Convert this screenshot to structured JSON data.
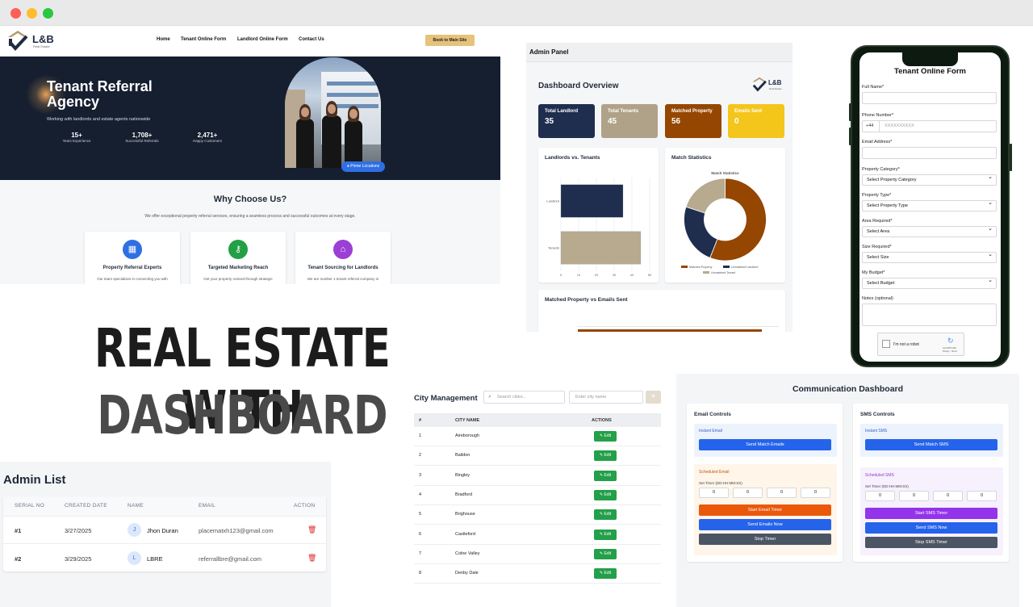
{
  "landing": {
    "logo": {
      "text": "L&B",
      "sub": "Real Estate"
    },
    "nav": [
      "Home",
      "Tenant Online Form",
      "Landlord Online Form",
      "Contact Us"
    ],
    "cta": "Book to Main Site",
    "hero_title": "Tenant Referral Agency",
    "hero_sub": "Working with landlords and estate agents nationwide",
    "stats": [
      {
        "value": "15+",
        "label": "Years Experience"
      },
      {
        "value": "1,708+",
        "label": "Successful Referrals"
      },
      {
        "value": "2,471+",
        "label": "Happy Customers"
      }
    ],
    "prime_badge": "Prime Locations",
    "why_title": "Why Choose Us?",
    "why_sub": "We offer exceptional property referral services, ensuring a seamless process and successful outcomes at every stage.",
    "cards": [
      {
        "title": "Property Referral Experts",
        "desc": "Our team specialises in connecting you with",
        "color": "#2f6fe4",
        "icon": "building-icon"
      },
      {
        "title": "Targeted Marketing Reach",
        "desc": "Get your property noticed through strategic",
        "color": "#22a046",
        "icon": "key-icon"
      },
      {
        "title": "Tenant Sourcing for Landlords",
        "desc": "We are number 1 tenant referral company in",
        "color": "#9b3fd6",
        "icon": "house-icon"
      }
    ]
  },
  "headline": {
    "line1": "REAL ESTATE WITH",
    "line2": "DASHBOARD"
  },
  "admin_panel": {
    "bar_title": "Admin Panel",
    "title": "Dashboard Overview",
    "logo_text": "L&B",
    "logo_sub": "Real Estate",
    "kpis": [
      {
        "label": "Total Landlord",
        "value": "35",
        "color": "#1f2d4e"
      },
      {
        "label": "Total Tenants",
        "value": "45",
        "color": "#b0a288"
      },
      {
        "label": "Matched Property",
        "value": "56",
        "color": "#954600"
      },
      {
        "label": "Emails Sent",
        "value": "0",
        "color": "#f4c61c"
      }
    ],
    "bar_chart_title": "Landlords vs. Tenants",
    "pie_chart_title": "Match Statistics",
    "bottom_chart_title": "Matched Property vs Emails Sent"
  },
  "chart_data": [
    {
      "type": "bar",
      "title": "Landlords vs. Tenants",
      "orientation": "horizontal",
      "categories": [
        "Landlord",
        "Tenants"
      ],
      "values": [
        35,
        45
      ],
      "colors": [
        "#1f2d4e",
        "#b7aa8e"
      ],
      "xticks": [
        "0",
        "10",
        "20",
        "30",
        "40",
        "50"
      ],
      "xlim": [
        0,
        50
      ]
    },
    {
      "type": "pie",
      "title": "Match Statistics",
      "donut": true,
      "labels": [
        "Matched Property",
        "Unmatched Landlord",
        "Unmatched Tenant"
      ],
      "values": [
        56,
        24,
        20
      ],
      "colors": [
        "#954600",
        "#1f2d4e",
        "#b7aa8e"
      ]
    }
  ],
  "phone_form": {
    "title": "Tenant Online Form",
    "fields": {
      "full_name": "Full Name*",
      "phone": "Phone Number*",
      "phone_code": "+44",
      "phone_placeholder": "XXXXXXXXXX",
      "email": "Email Address*",
      "category_label": "Property Category*",
      "category_value": "Select Property Category",
      "type_label": "Property Type*",
      "type_value": "Select Property Type",
      "area_label": "Area Required*",
      "area_value": "Select Area",
      "size_label": "Size Required*",
      "size_value": "Select Size",
      "budget_label": "My Budget*",
      "budget_value": "Select Budget",
      "notes_label": "Notes (optional)",
      "captcha": "I'm not a robot",
      "captcha_brand": "reCAPTCHA",
      "captcha_links": "Privacy - Terms"
    }
  },
  "city": {
    "title": "City Management",
    "search_placeholder": "Search cities...",
    "input_placeholder": "Enter city name",
    "add": "+",
    "headers": [
      "#",
      "CITY NAME",
      "ACTIONS"
    ],
    "edit_label": "Edit",
    "rows": [
      {
        "n": "1",
        "name": "Aireborough"
      },
      {
        "n": "2",
        "name": "Baildon"
      },
      {
        "n": "3",
        "name": "Bingley"
      },
      {
        "n": "4",
        "name": "Bradford"
      },
      {
        "n": "5",
        "name": "Brighouse"
      },
      {
        "n": "6",
        "name": "Castleford"
      },
      {
        "n": "7",
        "name": "Colne Valley"
      },
      {
        "n": "8",
        "name": "Denby Dale"
      }
    ]
  },
  "comm": {
    "title": "Communication Dashboard",
    "email": {
      "title": "Email Controls",
      "instant": "Instant Email",
      "send_match": "Send Match Emails",
      "scheduled": "Scheduled Email",
      "timer_label": "Set Timer (DD:HH:MM:SS)",
      "timer": [
        "0",
        "0",
        "0",
        "0"
      ],
      "start": "Start Email Timer",
      "send_now": "Send Emails Now",
      "stop": "Stop Timer"
    },
    "sms": {
      "title": "SMS Controls",
      "instant": "Instant SMS",
      "send_match": "Send Match SMS",
      "scheduled": "Scheduled SMS",
      "timer_label": "Set Timer (DD:HH:MM:SS)",
      "timer": [
        "0",
        "0",
        "0",
        "0"
      ],
      "start": "Start SMS Timer",
      "send_now": "Send SMS Now",
      "stop": "Stop SMS Timer"
    }
  },
  "admin_list": {
    "title": "Admin List",
    "headers": [
      "SERIAL NO",
      "CREATED DATE",
      "NAME",
      "EMAIL",
      "ACTION"
    ],
    "rows": [
      {
        "serial": "#1",
        "date": "3/27/2025",
        "initial": "J",
        "name": "Jhon Duran",
        "email": "placematxh123@gmail.com"
      },
      {
        "serial": "#2",
        "date": "3/29/2025",
        "initial": "L",
        "name": "LBRE",
        "email": "referrallbre@gmail.com"
      }
    ]
  }
}
